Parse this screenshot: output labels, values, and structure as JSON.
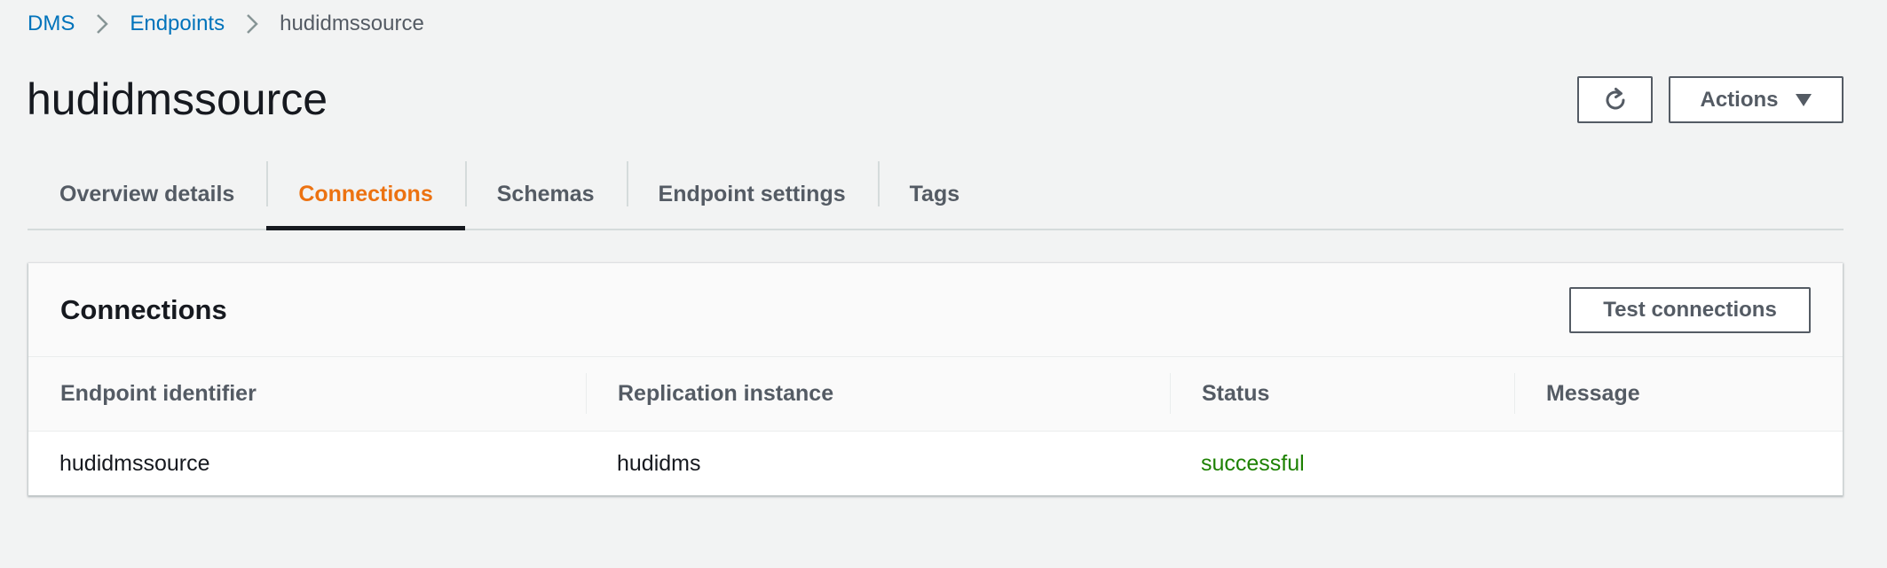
{
  "breadcrumb": {
    "items": [
      {
        "label": "DMS"
      },
      {
        "label": "Endpoints"
      },
      {
        "label": "hudidmssource"
      }
    ]
  },
  "header": {
    "title": "hudidmssource",
    "refresh_icon": "refresh-icon",
    "actions_label": "Actions"
  },
  "tabs": [
    {
      "label": "Overview details",
      "active": false
    },
    {
      "label": "Connections",
      "active": true
    },
    {
      "label": "Schemas",
      "active": false
    },
    {
      "label": "Endpoint settings",
      "active": false
    },
    {
      "label": "Tags",
      "active": false
    }
  ],
  "connections": {
    "title": "Connections",
    "test_button_label": "Test connections",
    "columns": [
      "Endpoint identifier",
      "Replication instance",
      "Status",
      "Message"
    ],
    "rows": [
      {
        "endpoint_identifier": "hudidmssource",
        "replication_instance": "hudidms",
        "status": "successful",
        "message": ""
      }
    ]
  },
  "colors": {
    "link": "#0073bb",
    "active_tab": "#ec7211",
    "status_success": "#1d8102",
    "background": "#f2f3f3"
  }
}
